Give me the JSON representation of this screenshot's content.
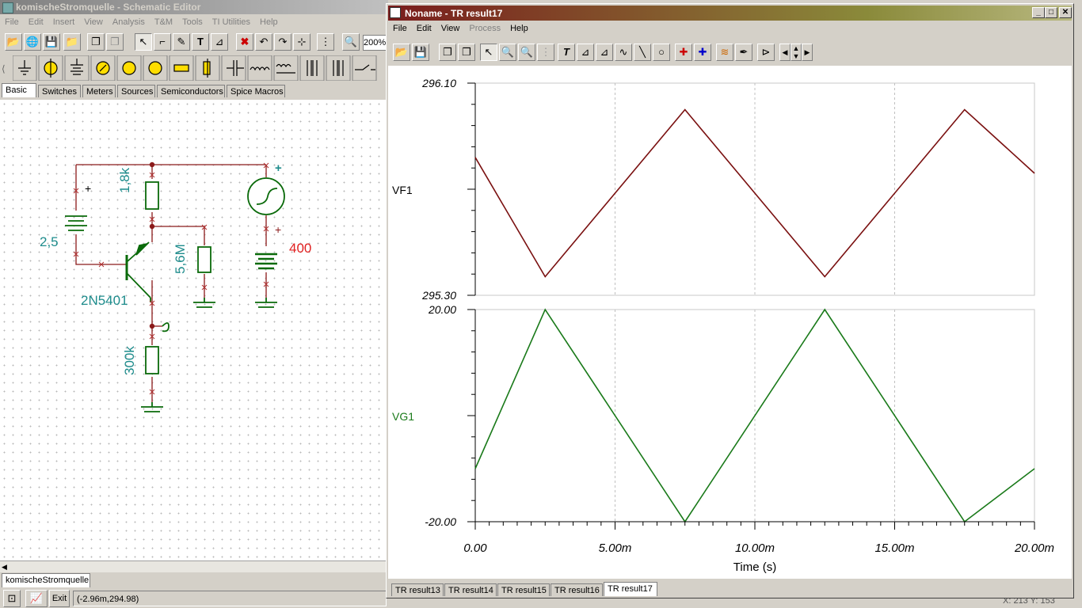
{
  "schematic_editor": {
    "title": "komischeStromquelle - Schematic Editor",
    "menu": [
      "File",
      "Edit",
      "Insert",
      "View",
      "Analysis",
      "T&M",
      "Tools",
      "TI Utilities",
      "Help"
    ],
    "zoom_value": "200%",
    "component_tabs": [
      "Basic",
      "Switches",
      "Meters",
      "Sources",
      "Semiconductors",
      "Spice Macros"
    ],
    "selected_tab": "Basic",
    "doc_tab": "komischeStromquelle",
    "status_exit": "Exit",
    "status_coords": "(-2.96m,294.98)",
    "status_right": "X: 213  Y: 153",
    "components": {
      "battery_value": "2,5",
      "resistor_top": "1,8k",
      "resistor_mid": "5,6M",
      "transistor": "2N5401",
      "resistor_bottom": "300k",
      "source_value": "400",
      "plus": "+"
    }
  },
  "result_window": {
    "title": "Noname - TR result17",
    "menu": [
      "File",
      "Edit",
      "View",
      "Process",
      "Help"
    ],
    "tabs": [
      "TR result13",
      "TR result14",
      "TR result15",
      "TR result16",
      "TR result17"
    ],
    "selected_tab": "TR result17"
  },
  "chart_data": [
    {
      "type": "line",
      "series": [
        {
          "name": "VF1",
          "color": "#7a1010",
          "x": [
            0.0,
            2.5,
            7.5,
            12.5,
            17.5,
            20.0
          ],
          "y": [
            295.82,
            295.37,
            296.0,
            295.37,
            296.0,
            295.76
          ]
        }
      ],
      "ylim": [
        295.3,
        296.1
      ],
      "yticks_labels": [
        "296.10",
        "295.30"
      ],
      "xlim": [
        0.0,
        20.0
      ],
      "grid": "vertical dashed"
    },
    {
      "type": "line",
      "series": [
        {
          "name": "VG1",
          "color": "#1a7a1a",
          "x": [
            0.0,
            2.5,
            7.5,
            12.5,
            17.5,
            20.0
          ],
          "y": [
            -10.0,
            20.0,
            -20.0,
            20.0,
            -20.0,
            -10.0
          ]
        }
      ],
      "ylim": [
        -20.0,
        20.0
      ],
      "yticks_labels": [
        "20.00",
        "-20.00"
      ],
      "xlim": [
        0.0,
        20.0
      ],
      "xtick_labels": [
        "0.00",
        "5.00m",
        "10.00m",
        "15.00m",
        "20.00m"
      ],
      "xlabel": "Time (s)"
    }
  ]
}
